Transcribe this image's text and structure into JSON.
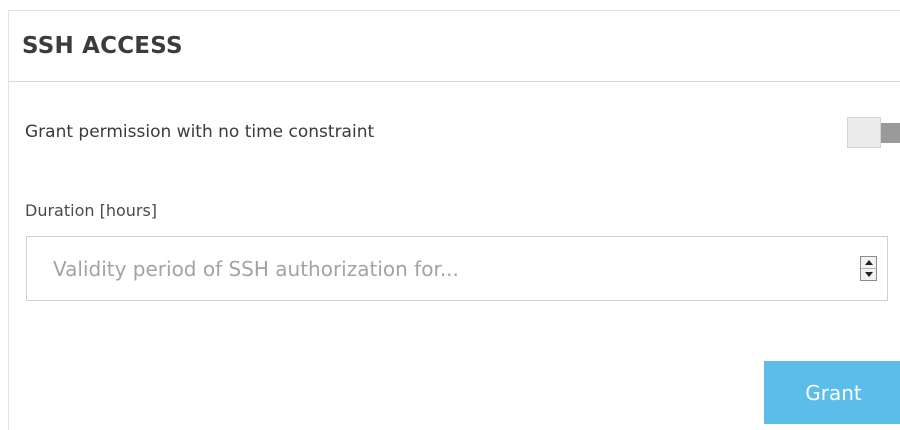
{
  "panel": {
    "title": "SSH ACCESS"
  },
  "toggle": {
    "label": "Grant permission with no time constraint",
    "state": "off"
  },
  "duration": {
    "label": "Duration [hours]",
    "value": "",
    "placeholder": "Validity period of SSH authorization for..."
  },
  "actions": {
    "grant_label": "Grant"
  },
  "colors": {
    "accent": "#5bbde8",
    "toggle_track": "#9a9a9a"
  }
}
